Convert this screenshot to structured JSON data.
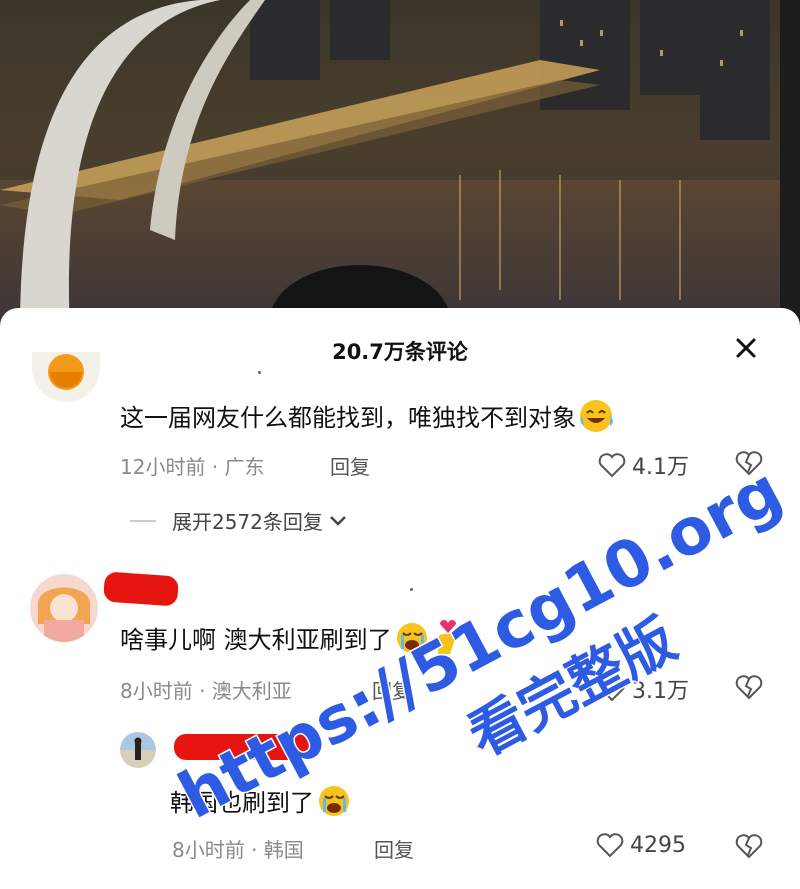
{
  "sheet": {
    "title": "20.7万条评论",
    "close_label": "✕"
  },
  "comments": [
    {
      "text": "这一届网友什么都能找到，唯独找不到对象",
      "emoji": "laughing-crying-emoji",
      "time": "12小时前 · 广东",
      "reply": "回复",
      "likes": "4.1万",
      "expand": "展开2572条回复"
    },
    {
      "text": "啥事儿啊 澳大利亚刷到了",
      "emoji": "crying-emoji",
      "time": "8小时前 · 澳大利亚",
      "reply": "回复",
      "likes": "3.1万"
    },
    {
      "text": "韩国也刷到了",
      "emoji": "crying-emoji",
      "time": "8小时前 · 韩国",
      "reply": "回复",
      "likes": "4295"
    }
  ],
  "watermark": {
    "line1": "https://51cg10.org",
    "line2": "看完整版"
  },
  "colors": {
    "accent": "#2d5be3",
    "redact": "#e6150f"
  }
}
